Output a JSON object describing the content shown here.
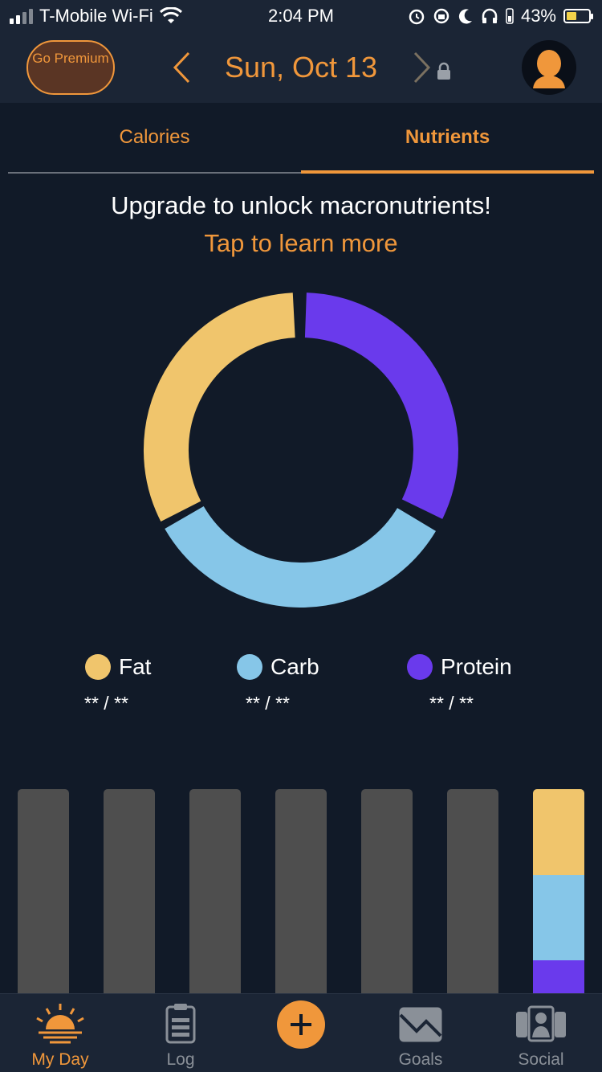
{
  "status_bar": {
    "carrier": "T-Mobile Wi-Fi",
    "time": "2:04 PM",
    "battery": "43%"
  },
  "header": {
    "premium_label": "Go Premium",
    "date": "Sun, Oct 13"
  },
  "tabs": [
    {
      "label": "Calories",
      "active": false
    },
    {
      "label": "Nutrients",
      "active": true
    }
  ],
  "promo": {
    "message": "Upgrade to unlock macronutrients!",
    "link": "Tap to learn more"
  },
  "macros": {
    "donut": {
      "fat": {
        "start_deg": -3,
        "end_deg": -117
      },
      "carb": {
        "start_deg": 240,
        "end_deg": 121
      },
      "protein": {
        "start_deg": 2,
        "end_deg": 116
      }
    },
    "legend": [
      {
        "label": "Fat",
        "value": "** / **",
        "color": "#f0c56c"
      },
      {
        "label": "Carb",
        "value": "** / **",
        "color": "#86c6e8"
      },
      {
        "label": "Protein",
        "value": "** / **",
        "color": "#6a3aec"
      }
    ]
  },
  "colors": {
    "accent": "#f0973b",
    "background": "#111a28",
    "header": "#1b2535",
    "fat": "#f0c56c",
    "carb": "#86c6e8",
    "protein": "#6a3aec",
    "bar_empty": "#4e4e4e"
  },
  "weekly_bars": [
    {
      "filled": false
    },
    {
      "filled": false
    },
    {
      "filled": false
    },
    {
      "filled": false
    },
    {
      "filled": false
    },
    {
      "filled": false
    },
    {
      "filled": true,
      "fat_fraction": 0.42,
      "carb_fraction": 0.42,
      "protein_fraction": 0.16
    }
  ],
  "tabbar": {
    "my_day": "My Day",
    "log": "Log",
    "add_icon": "plus-icon",
    "goals": "Goals",
    "social": "Social"
  }
}
